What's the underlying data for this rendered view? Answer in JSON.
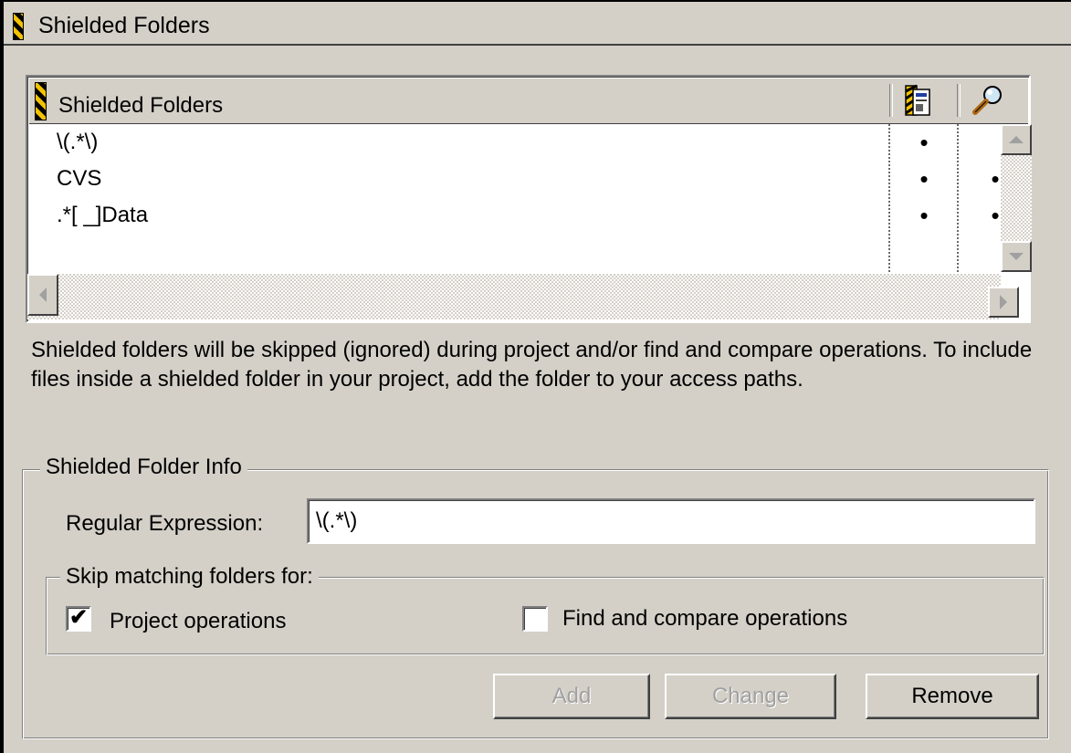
{
  "window": {
    "title": "Shielded Folders",
    "title_icon": "hazard-stripe-icon"
  },
  "list": {
    "header_label": "Shielded Folders",
    "header_icon": "hazard-stripe-icon",
    "column_icons": [
      "project-file-icon",
      "magnifier-icon"
    ],
    "rows": [
      {
        "name": "\\(.*\\)",
        "project": "•",
        "find": ""
      },
      {
        "name": "CVS",
        "project": "•",
        "find": "•"
      },
      {
        "name": ".*[ _]Data",
        "project": "•",
        "find": "•"
      }
    ]
  },
  "description": "Shielded folders will be skipped (ignored) during project and/or find and compare operations. To include files inside a shielded folder in your project, add the folder to your access paths.",
  "info": {
    "group_label": "Shielded Folder Info",
    "regex_label": "Regular Expression:",
    "regex_value": "\\(.*\\)",
    "skip_group_label": "Skip matching folders for:",
    "project_ops_label": "Project operations",
    "project_ops_checked": true,
    "find_ops_label": "Find and compare operations",
    "find_ops_checked": false
  },
  "buttons": {
    "add": "Add",
    "change": "Change",
    "remove": "Remove"
  },
  "colors": {
    "face": "#d4d0c8",
    "hazard_yellow": "#f2c200",
    "disabled_text": "#a0a0a0"
  }
}
